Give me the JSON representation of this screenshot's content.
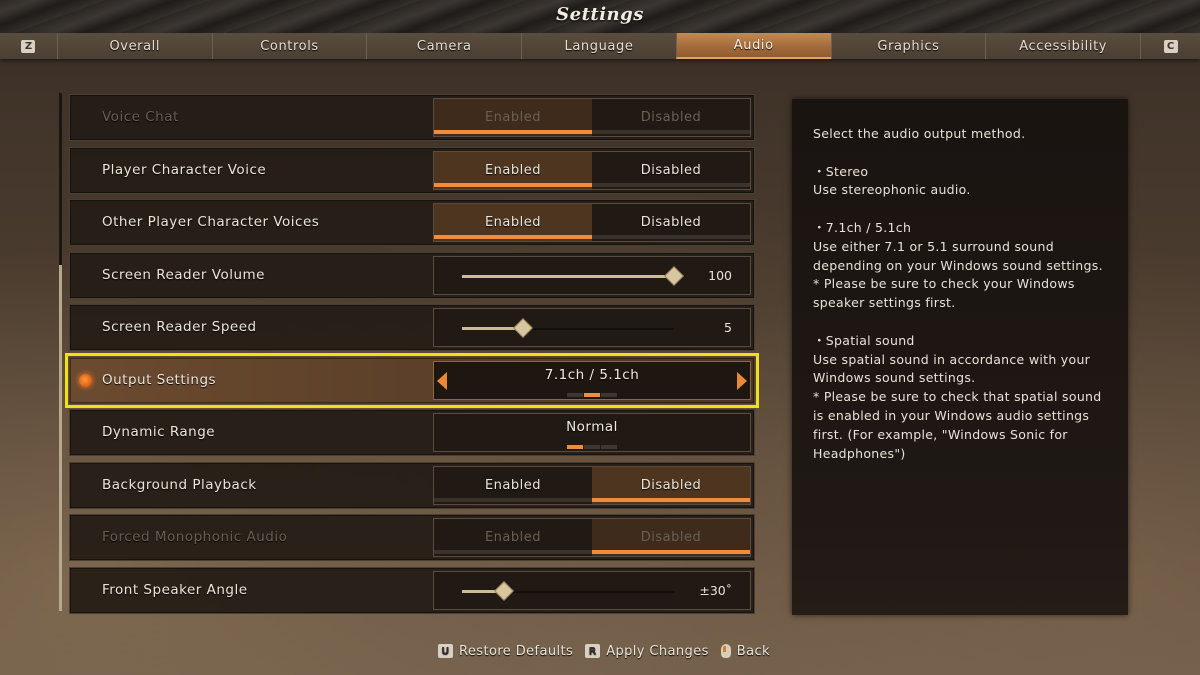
{
  "header": {
    "title": "Settings"
  },
  "tabs": {
    "prev_key": "Z",
    "next_key": "C",
    "items": [
      {
        "label": "Overall",
        "active": false
      },
      {
        "label": "Controls",
        "active": false
      },
      {
        "label": "Camera",
        "active": false
      },
      {
        "label": "Language",
        "active": false
      },
      {
        "label": "Audio",
        "active": true
      },
      {
        "label": "Graphics",
        "active": false
      },
      {
        "label": "Accessibility",
        "active": false
      }
    ]
  },
  "settings": {
    "voice_chat": {
      "label": "Voice Chat",
      "options": [
        "Enabled",
        "Disabled"
      ],
      "selected": "Enabled",
      "disabled": true
    },
    "player_character_voice": {
      "label": "Player Character Voice",
      "options": [
        "Enabled",
        "Disabled"
      ],
      "selected": "Enabled"
    },
    "other_player_character_voices": {
      "label": "Other Player Character Voices",
      "options": [
        "Enabled",
        "Disabled"
      ],
      "selected": "Enabled"
    },
    "screen_reader_volume": {
      "label": "Screen Reader Volume",
      "value": "100",
      "fraction": 1.0
    },
    "screen_reader_speed": {
      "label": "Screen Reader Speed",
      "value": "5",
      "fraction": 0.29
    },
    "output_settings": {
      "label": "Output Settings",
      "value": "7.1ch / 5.1ch",
      "option_index": 1,
      "option_count": 3,
      "selected_row": true
    },
    "dynamic_range": {
      "label": "Dynamic Range",
      "value": "Normal",
      "option_index": 0,
      "option_count": 3
    },
    "background_playback": {
      "label": "Background Playback",
      "options": [
        "Enabled",
        "Disabled"
      ],
      "selected": "Disabled"
    },
    "forced_monophonic_audio": {
      "label": "Forced Monophonic Audio",
      "options": [
        "Enabled",
        "Disabled"
      ],
      "selected": "Disabled",
      "disabled": true
    },
    "front_speaker_angle": {
      "label": "Front Speaker Angle",
      "value": "±30˚",
      "fraction": 0.2
    }
  },
  "description": {
    "intro": "Select the audio output method.",
    "stereo_title": "・Stereo",
    "stereo_body": "Use stereophonic audio.",
    "surround_title": "・7.1ch / 5.1ch",
    "surround_body": "Use either 7.1 or 5.1 surround sound depending on your Windows sound settings.",
    "surround_note": "* Please be sure to check your Windows speaker settings first.",
    "spatial_title": "・Spatial sound",
    "spatial_body": "Use spatial sound in accordance with your Windows sound settings.",
    "spatial_note": "* Please be sure to check that spatial sound is enabled in your Windows audio settings first. (For example, \"Windows Sonic for Headphones\")"
  },
  "footer": {
    "restore_key": "U",
    "restore_label": "Restore Defaults",
    "apply_key": "R",
    "apply_label": "Apply Changes",
    "back_icon": "mouse-right-click-icon",
    "back_label": "Back"
  },
  "colors": {
    "accent_orange": "#ef8d3c",
    "selection_outline": "#f0e01a",
    "active_tab": "#a26a3a"
  }
}
